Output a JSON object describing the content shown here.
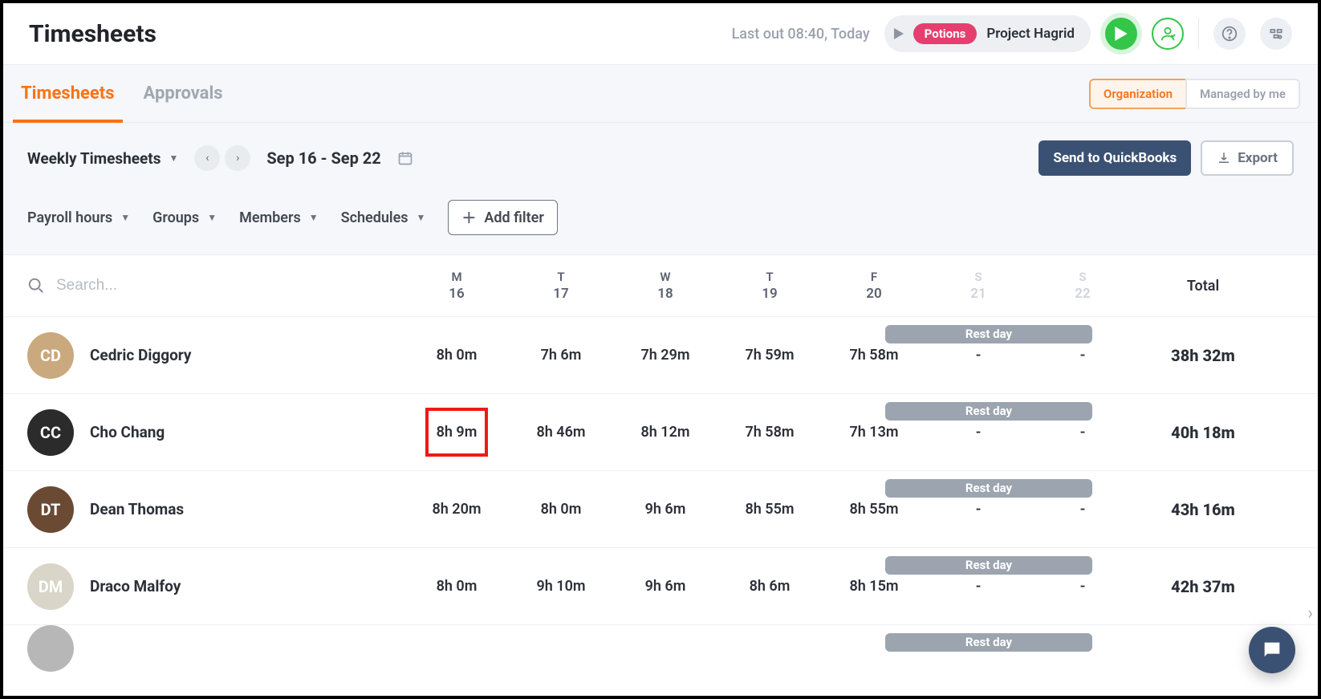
{
  "header": {
    "title": "Timesheets",
    "status_text": "Last out 08:40, Today",
    "badge": "Potions",
    "project": "Project Hagrid"
  },
  "tabs": {
    "timesheets": "Timesheets",
    "approvals": "Approvals",
    "scope_org": "Organization",
    "scope_me": "Managed by me"
  },
  "controls": {
    "view_label": "Weekly Timesheets",
    "date_range": "Sep 16 - Sep 22",
    "send_qb_label": "Send to QuickBooks",
    "export_label": "Export"
  },
  "filters": {
    "payroll": "Payroll hours",
    "groups": "Groups",
    "members": "Members",
    "schedules": "Schedules",
    "add_filter": "Add filter"
  },
  "table": {
    "search_placeholder": "Search...",
    "days": [
      {
        "dow": "M",
        "num": "16",
        "weekend": false
      },
      {
        "dow": "T",
        "num": "17",
        "weekend": false
      },
      {
        "dow": "W",
        "num": "18",
        "weekend": false
      },
      {
        "dow": "T",
        "num": "19",
        "weekend": false
      },
      {
        "dow": "F",
        "num": "20",
        "weekend": false
      },
      {
        "dow": "S",
        "num": "21",
        "weekend": true
      },
      {
        "dow": "S",
        "num": "22",
        "weekend": true
      }
    ],
    "total_label": "Total",
    "rest_day_label": "Rest day",
    "rows": [
      {
        "name": "Cedric Diggory",
        "avatar_bg": "#c9a97d",
        "initials": "CD",
        "cells": [
          "8h 0m",
          "7h 6m",
          "7h 29m",
          "7h 59m",
          "7h 58m",
          "-",
          "-"
        ],
        "total": "38h 32m",
        "highlight_index": -1
      },
      {
        "name": "Cho Chang",
        "avatar_bg": "#2b2b2b",
        "initials": "CC",
        "cells": [
          "8h 9m",
          "8h 46m",
          "8h 12m",
          "7h 58m",
          "7h 13m",
          "-",
          "-"
        ],
        "total": "40h 18m",
        "highlight_index": 0
      },
      {
        "name": "Dean Thomas",
        "avatar_bg": "#6b4a33",
        "initials": "DT",
        "cells": [
          "8h 20m",
          "8h 0m",
          "9h 6m",
          "8h 55m",
          "8h 55m",
          "-",
          "-"
        ],
        "total": "43h 16m",
        "highlight_index": -1
      },
      {
        "name": "Draco Malfoy",
        "avatar_bg": "#d9d5c8",
        "initials": "DM",
        "cells": [
          "8h 0m",
          "9h 10m",
          "9h 6m",
          "8h 6m",
          "8h 15m",
          "-",
          "-"
        ],
        "total": "42h 37m",
        "highlight_index": -1
      }
    ]
  }
}
